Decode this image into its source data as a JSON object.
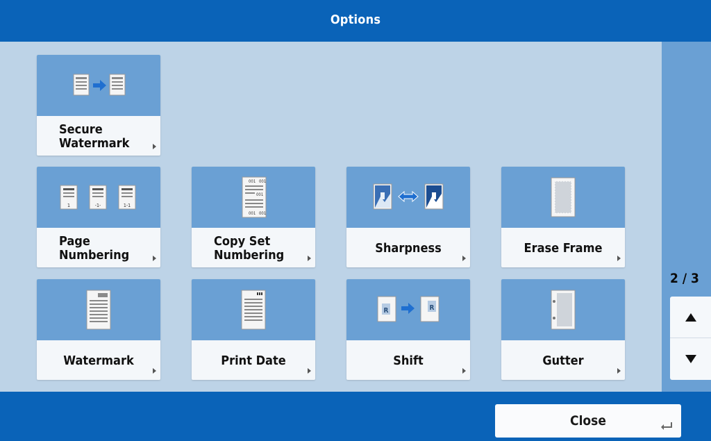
{
  "header": {
    "title": "Options"
  },
  "tiles": [
    {
      "label": "Secure\nWatermark",
      "icon": "secure-watermark-icon"
    },
    {
      "label": "Page\nNumbering",
      "icon": "page-numbering-icon"
    },
    {
      "label": "Copy Set\nNumbering",
      "icon": "copy-set-numbering-icon"
    },
    {
      "label": "Sharpness",
      "icon": "sharpness-icon"
    },
    {
      "label": "Erase Frame",
      "icon": "erase-frame-icon"
    },
    {
      "label": "Watermark",
      "icon": "watermark-icon"
    },
    {
      "label": "Print Date",
      "icon": "print-date-icon"
    },
    {
      "label": "Shift",
      "icon": "shift-icon"
    },
    {
      "label": "Gutter",
      "icon": "gutter-icon"
    }
  ],
  "pager": {
    "indicator": "2 / 3"
  },
  "footer": {
    "close_label": "Close"
  },
  "colors": {
    "header": "#0a63b8",
    "tile_icon_bg": "#6aa0d4",
    "background": "#bdd3e7"
  }
}
